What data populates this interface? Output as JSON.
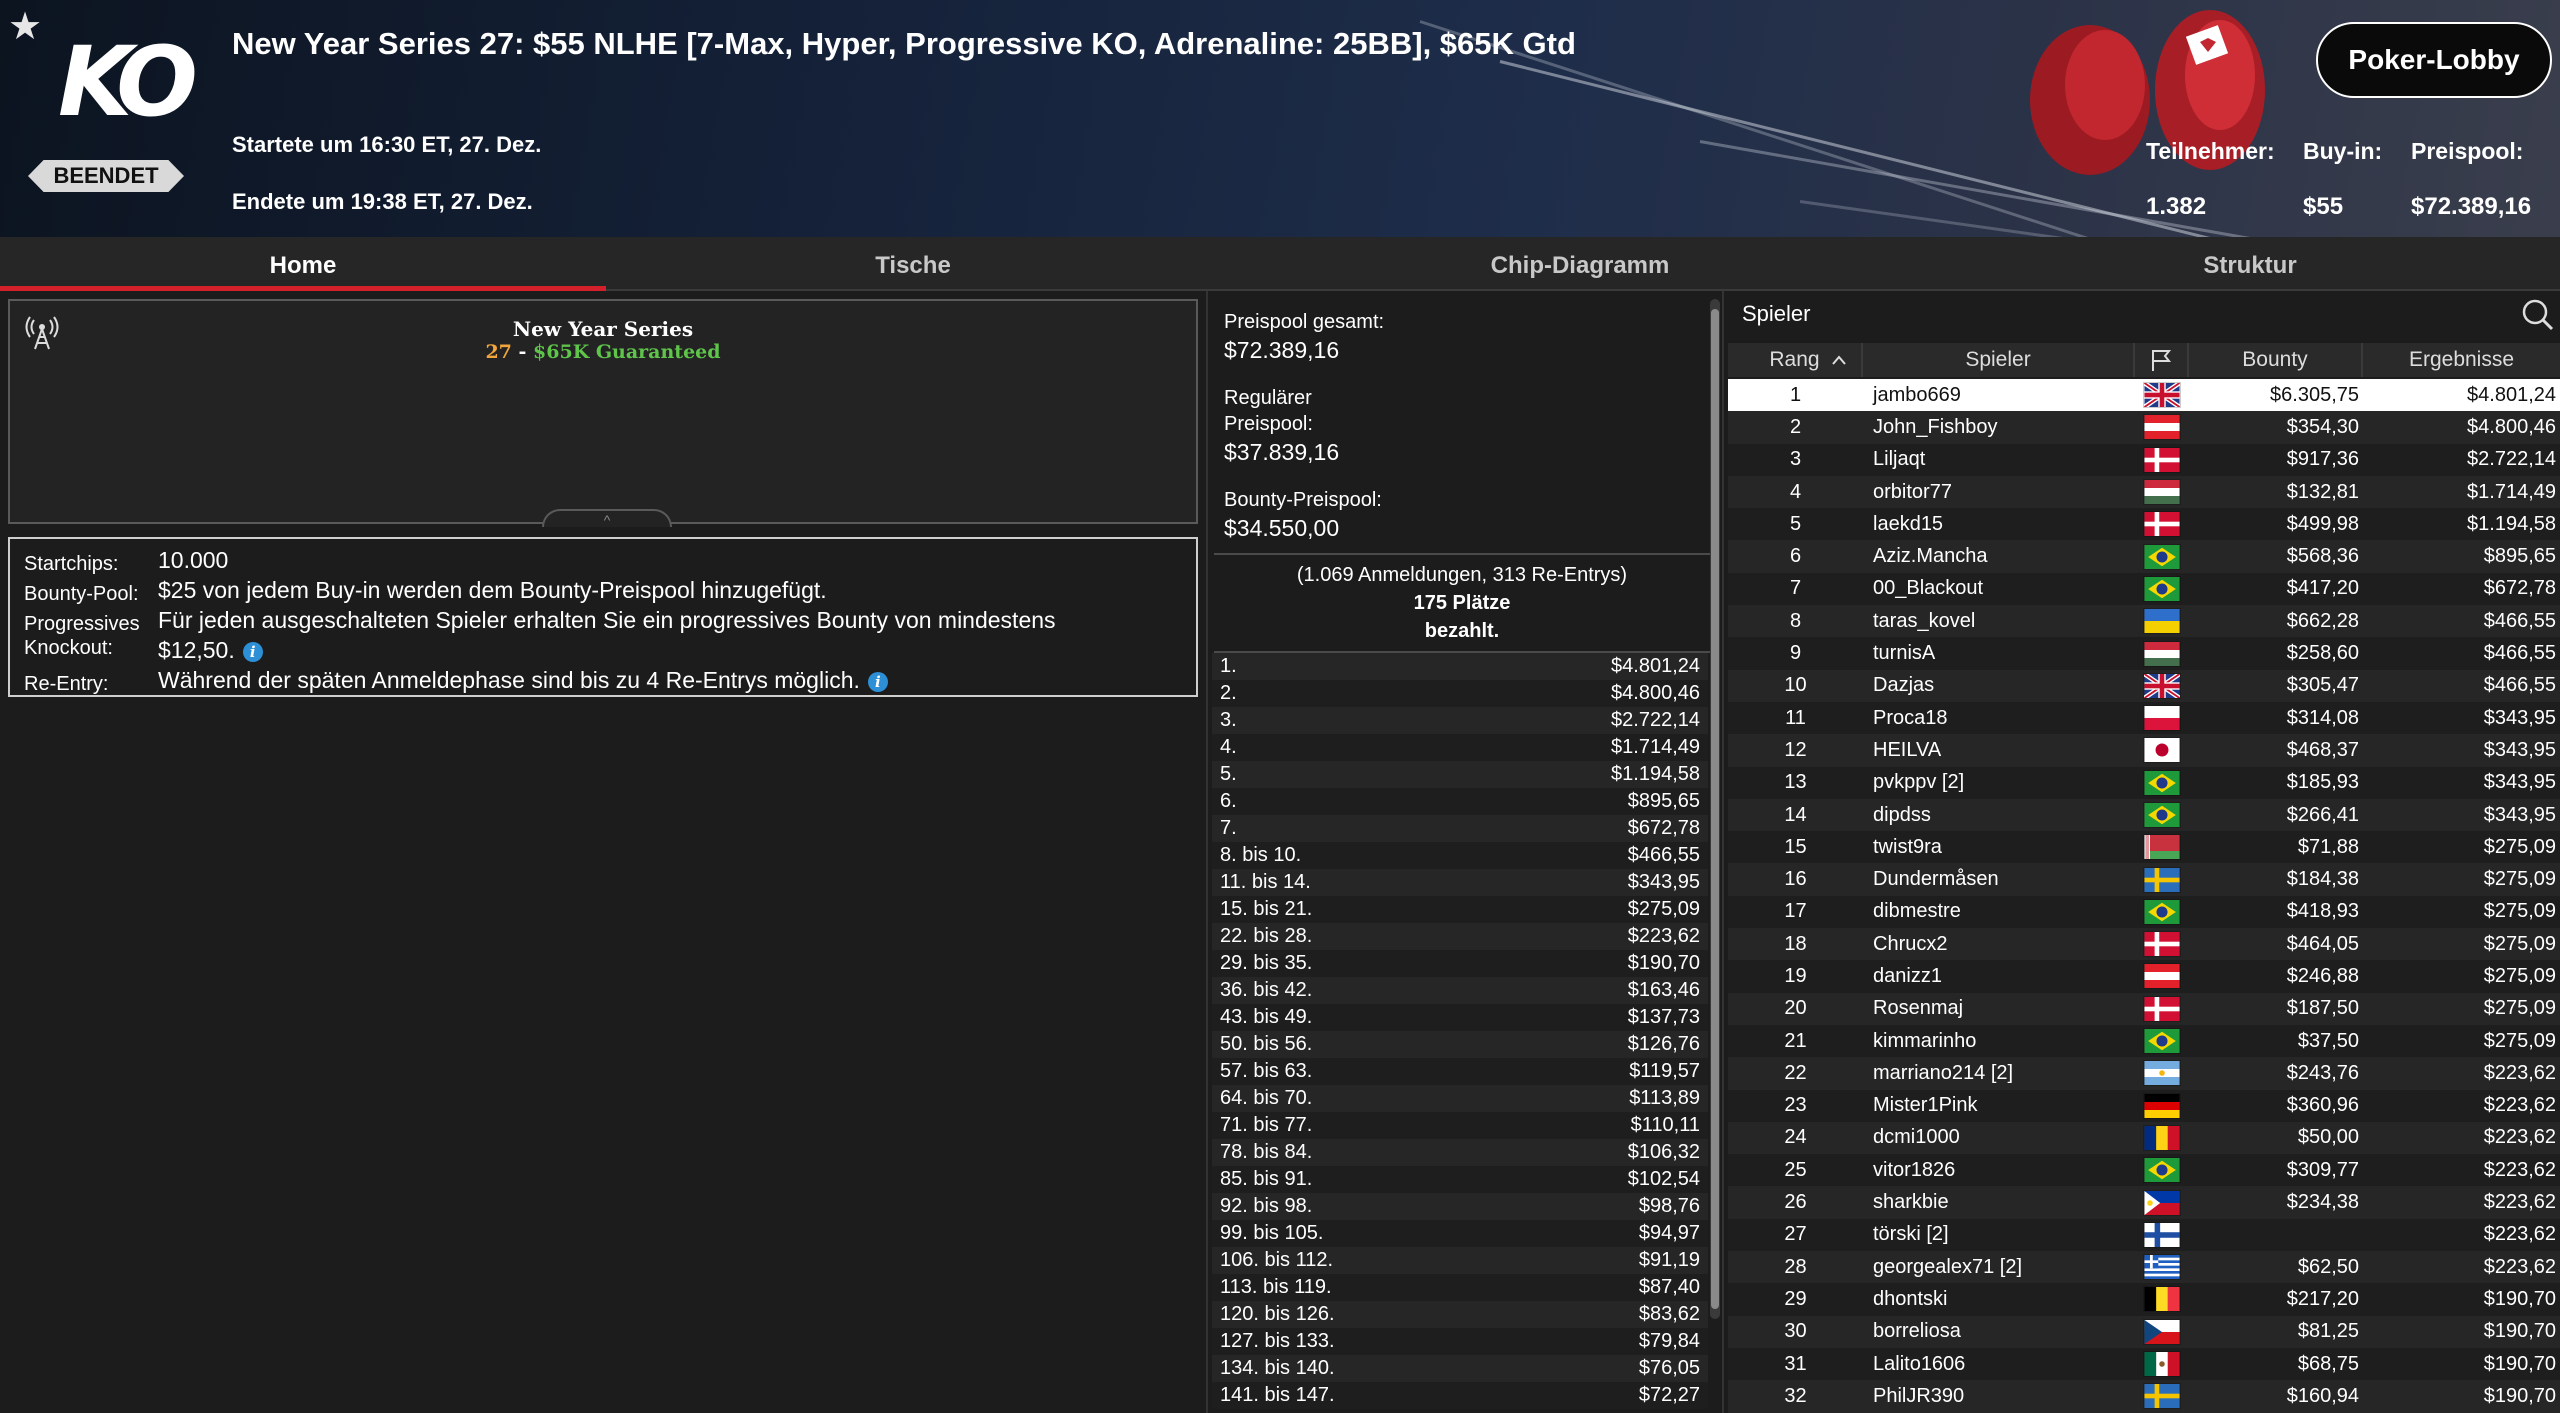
{
  "header": {
    "title": "New Year Series 27: $55 NLHE [7-Max, Hyper, Progressive KO, Adrenaline: 25BB], $65K Gtd",
    "logo_text": "KO",
    "status": "BEENDET",
    "started": "Startete um 16:30 ET, 27. Dez.",
    "ended": "Endete um 19:38 ET, 27. Dez.",
    "lobby_button": "Poker-Lobby",
    "stats": {
      "participants_label": "Teilnehmer:",
      "participants_value": "1.382",
      "buyin_label": "Buy-in:",
      "buyin_value": "$55",
      "prizepool_label": "Preispool:",
      "prizepool_value": "$72.389,16"
    }
  },
  "tabs": [
    "Home",
    "Tische",
    "Chip-Diagramm",
    "Struktur"
  ],
  "info": {
    "series_name": "New Year Series",
    "series_number": "27",
    "series_dash": "-",
    "series_guarantee": "$65K Guaranteed",
    "details": {
      "startchips_label": "Startchips:",
      "startchips_value": "10.000",
      "bountypool_label": "Bounty-Pool:",
      "bountypool_value": "$25 von jedem Buy-in werden dem Bounty-Preispool hinzugefügt.",
      "progressive_label_1": "Progressives",
      "progressive_label_2": "Knockout:",
      "progressive_value_1": "Für jeden ausgeschalteten Spieler erhalten Sie ein progressives Bounty von mindestens",
      "progressive_value_2": "$12,50.",
      "reentry_label": "Re-Entry:",
      "reentry_value": "Während der späten Anmeldephase sind bis zu 4 Re-Entrys möglich.",
      "info_glyph": "i"
    }
  },
  "prizepool": {
    "total_label": "Preispool gesamt:",
    "total_value": "$72.389,16",
    "regular_label_1": "Regulärer",
    "regular_label_2": "Preispool:",
    "regular_value": "$37.839,16",
    "bounty_label": "Bounty-Preispool:",
    "bounty_value": "$34.550,00",
    "entries_summary": "(1.069 Anmeldungen, 313 Re-Entrys)",
    "places_paid": "175 Plätze",
    "paid_label": "bezahlt.",
    "payouts": [
      [
        "1.",
        "$4.801,24"
      ],
      [
        "2.",
        "$4.800,46"
      ],
      [
        "3.",
        "$2.722,14"
      ],
      [
        "4.",
        "$1.714,49"
      ],
      [
        "5.",
        "$1.194,58"
      ],
      [
        "6.",
        "$895,65"
      ],
      [
        "7.",
        "$672,78"
      ],
      [
        "8. bis 10.",
        "$466,55"
      ],
      [
        "11. bis 14.",
        "$343,95"
      ],
      [
        "15. bis 21.",
        "$275,09"
      ],
      [
        "22. bis 28.",
        "$223,62"
      ],
      [
        "29. bis 35.",
        "$190,70"
      ],
      [
        "36. bis 42.",
        "$163,46"
      ],
      [
        "43. bis 49.",
        "$137,73"
      ],
      [
        "50. bis 56.",
        "$126,76"
      ],
      [
        "57. bis 63.",
        "$119,57"
      ],
      [
        "64. bis 70.",
        "$113,89"
      ],
      [
        "71. bis 77.",
        "$110,11"
      ],
      [
        "78. bis 84.",
        "$106,32"
      ],
      [
        "85. bis 91.",
        "$102,54"
      ],
      [
        "92. bis 98.",
        "$98,76"
      ],
      [
        "99. bis 105.",
        "$94,97"
      ],
      [
        "106. bis 112.",
        "$91,19"
      ],
      [
        "113. bis 119.",
        "$87,40"
      ],
      [
        "120. bis 126.",
        "$83,62"
      ],
      [
        "127. bis 133.",
        "$79,84"
      ],
      [
        "134. bis 140.",
        "$76,05"
      ],
      [
        "141. bis 147.",
        "$72,27"
      ]
    ]
  },
  "players": {
    "title": "Spieler",
    "columns": [
      "Rang",
      "Spieler",
      "",
      "Bounty",
      "Ergebnisse"
    ],
    "sort_icon": "chevron-up-icon",
    "rows": [
      [
        "1",
        "jambo669",
        "gb",
        "$6.305,75",
        "$4.801,24"
      ],
      [
        "2",
        "John_Fishboy",
        "at",
        "$354,30",
        "$4.800,46"
      ],
      [
        "3",
        "Liljaqt",
        "dk",
        "$917,36",
        "$2.722,14"
      ],
      [
        "4",
        "orbitor77",
        "hu",
        "$132,81",
        "$1.714,49"
      ],
      [
        "5",
        "laekd15",
        "dk",
        "$499,98",
        "$1.194,58"
      ],
      [
        "6",
        "Aziz.Mancha",
        "br",
        "$568,36",
        "$895,65"
      ],
      [
        "7",
        "00_Blackout",
        "br",
        "$417,20",
        "$672,78"
      ],
      [
        "8",
        "taras_kovel",
        "ua",
        "$662,28",
        "$466,55"
      ],
      [
        "9",
        "turnisA",
        "hu",
        "$258,60",
        "$466,55"
      ],
      [
        "10",
        "Dazjas",
        "gb",
        "$305,47",
        "$466,55"
      ],
      [
        "11",
        "Proca18",
        "pl",
        "$314,08",
        "$343,95"
      ],
      [
        "12",
        "HEILVA",
        "jp",
        "$468,37",
        "$343,95"
      ],
      [
        "13",
        "pvkppv [2]",
        "br",
        "$185,93",
        "$343,95"
      ],
      [
        "14",
        "dipdss",
        "br",
        "$266,41",
        "$343,95"
      ],
      [
        "15",
        "twist9ra",
        "by",
        "$71,88",
        "$275,09"
      ],
      [
        "16",
        "Dundermåsen",
        "se",
        "$184,38",
        "$275,09"
      ],
      [
        "17",
        "dibmestre",
        "br",
        "$418,93",
        "$275,09"
      ],
      [
        "18",
        "Chrucx2",
        "dk",
        "$464,05",
        "$275,09"
      ],
      [
        "19",
        "danizz1",
        "at",
        "$246,88",
        "$275,09"
      ],
      [
        "20",
        "Rosenmaj",
        "dk",
        "$187,50",
        "$275,09"
      ],
      [
        "21",
        "kimmarinho",
        "br",
        "$37,50",
        "$275,09"
      ],
      [
        "22",
        "marriano214 [2]",
        "ar",
        "$243,76",
        "$223,62"
      ],
      [
        "23",
        "Mister1Pink",
        "de",
        "$360,96",
        "$223,62"
      ],
      [
        "24",
        "dcmi1000",
        "ro",
        "$50,00",
        "$223,62"
      ],
      [
        "25",
        "vitor1826",
        "br",
        "$309,77",
        "$223,62"
      ],
      [
        "26",
        "sharkbie",
        "ph",
        "$234,38",
        "$223,62"
      ],
      [
        "27",
        "törski [2]",
        "fi",
        "",
        "$223,62"
      ],
      [
        "28",
        "georgealex71 [2]",
        "gr",
        "$62,50",
        "$223,62"
      ],
      [
        "29",
        "dhontski",
        "be",
        "$217,20",
        "$190,70"
      ],
      [
        "30",
        "borreliosa",
        "cz",
        "$81,25",
        "$190,70"
      ],
      [
        "31",
        "Lalito1606",
        "mx",
        "$68,75",
        "$190,70"
      ],
      [
        "32",
        "PhilJR390",
        "se",
        "$160,94",
        "$190,70"
      ]
    ]
  },
  "colors": {
    "accent_red": "#d4202a",
    "guarantee_green": "#5ec44a",
    "series_orange": "#f2a53c",
    "info_blue": "#2d8fd6"
  }
}
